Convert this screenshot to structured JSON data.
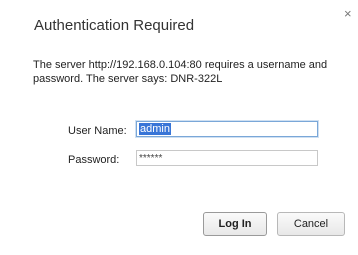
{
  "dialog": {
    "title": "Authentication Required",
    "close_glyph": "×",
    "message": "The server http://192.168.0.104:80 requires a username and password. The server says: DNR-322L"
  },
  "form": {
    "username_label": "User Name:",
    "username_value": "admin",
    "password_label": "Password:",
    "password_value": "******"
  },
  "buttons": {
    "login_label": "Log In",
    "cancel_label": "Cancel"
  }
}
